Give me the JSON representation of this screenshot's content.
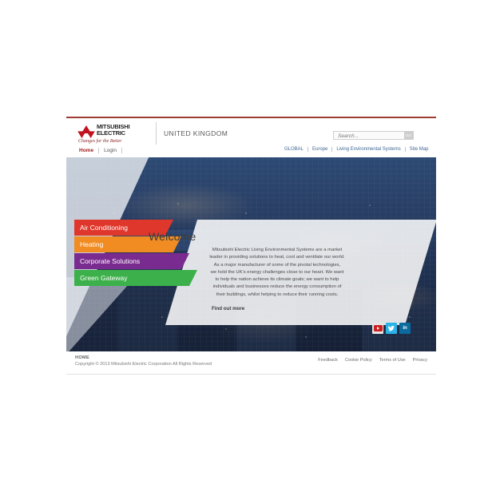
{
  "site": {
    "brand": {
      "name_line1": "MITSUBISHI",
      "name_line2": "ELECTRIC",
      "tagline": "Changes for the Better",
      "country": "UNITED KINGDOM"
    },
    "primary_nav": [
      {
        "label": "Home",
        "active": true
      },
      {
        "label": "Login",
        "active": false
      }
    ],
    "search": {
      "placeholder": "Search...",
      "value": "",
      "go_label": "GO"
    },
    "utility_nav": [
      {
        "label": "GLOBAL"
      },
      {
        "label": "Europe"
      },
      {
        "label": "Living Environmental Systems"
      },
      {
        "label": "Site Map"
      }
    ]
  },
  "hero": {
    "categories": [
      {
        "label": "Air Conditioning",
        "color": "#e0372c"
      },
      {
        "label": "Heating",
        "color": "#f08c22"
      },
      {
        "label": "Corporate Solutions",
        "color": "#7a2b8f"
      },
      {
        "label": "Green Gateway",
        "color": "#3cb04a"
      }
    ],
    "panel": {
      "title": "Welcome",
      "paragraphs": [
        "Mitsubishi Electric Living Environmental Systems are a market",
        "leader in providing solutions to heat, cool and ventilate our world.",
        "As a major manufacturer of some of the pivotal technologies,",
        "we hold the UK's energy challenges close to our heart. We want",
        "to help the nation achieve its climate goals; we want to help",
        "individuals and businesses reduce the energy consumption of",
        "their buildings, whilst helping to reduce their running costs."
      ],
      "cta": "Find out more"
    },
    "social": [
      {
        "name": "youtube",
        "label": "You Tube",
        "color": "#cc1f1f"
      },
      {
        "name": "twitter",
        "label": "t",
        "color": "#2ab3e8"
      },
      {
        "name": "linkedin",
        "label": "in",
        "color": "#0b6a9e"
      }
    ]
  },
  "footer": {
    "home_label": "HOME",
    "copyright": "Copyright © 2013 Mitsubishi Electric Corporation  All Rights Reserved",
    "links": [
      {
        "label": "Feedback"
      },
      {
        "label": "Cookie Policy"
      },
      {
        "label": "Terms of Use"
      },
      {
        "label": "Privacy"
      }
    ]
  },
  "colors": {
    "rule_red": "#9e3b33",
    "brand_red": "#9e1b1b",
    "link_blue": "#3f6694"
  }
}
